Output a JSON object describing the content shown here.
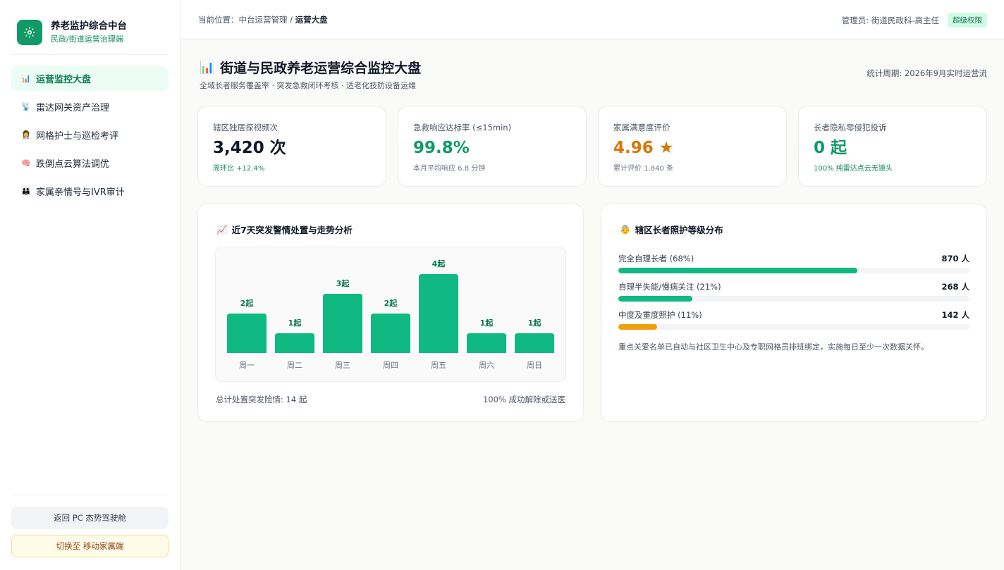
{
  "sidebar": {
    "brand_title": "养老监护综合中台",
    "brand_subtitle": "民政/街道运营治理端",
    "items": [
      {
        "icon": "📊",
        "label": "运营监控大盘",
        "active": true
      },
      {
        "icon": "📡",
        "label": "雷达网关资产治理",
        "active": false
      },
      {
        "icon": "👩‍⚕️",
        "label": "网格护士与巡检考评",
        "active": false
      },
      {
        "icon": "🧠",
        "label": "跌倒点云算法调优",
        "active": false
      },
      {
        "icon": "👪",
        "label": "家属亲情号与IVR审计",
        "active": false
      }
    ],
    "btn_back": "返回 PC 态势驾驶舱",
    "btn_switch": "切换至 移动家属端"
  },
  "topbar": {
    "crumb_prefix": "当前位置：中台运营管理 / ",
    "crumb_current": "运营大盘",
    "admin": "管理员: 街道民政科-高主任",
    "badge": "超级权限"
  },
  "page": {
    "title_icon": "📊",
    "title": "街道与民政养老运营综合监控大盘",
    "subtitle": "全域长者服务覆盖率 · 突发急救闭环考核 · 适老化技防设备运维",
    "period": "统计周期: 2026年9月实时运营流"
  },
  "kpis": [
    {
      "label": "辖区独居探视频次",
      "value": "3,420 次",
      "note": "周环比 +12.4%",
      "color": "#111827",
      "note_color": "#0f8a5f"
    },
    {
      "label": "急救响应达标率 (≤15min)",
      "value": "99.8%",
      "note": "本月平均响应 6.8 分钟",
      "color": "#0f9a67",
      "note_color": "#6b7280"
    },
    {
      "label": "家属满意度评价",
      "value": "4.96 ★",
      "note": "累计评价 1,840 条",
      "color": "#d97706",
      "note_color": "#6b7280"
    },
    {
      "label": "长者隐私零侵犯投诉",
      "value": "0 起",
      "note": "100% 纯雷达点云无镜头",
      "color": "#0f9a67",
      "note_color": "#0f8a5f"
    }
  ],
  "chart_card": {
    "icon": "📈",
    "title": "近7天突发警情处置与走势分析",
    "foot_left": "总计处置突发险情: 14 起",
    "foot_right": "100% 成功解除或送医"
  },
  "chart_data": {
    "type": "bar",
    "categories": [
      "周一",
      "周二",
      "周三",
      "周四",
      "周五",
      "周六",
      "周日"
    ],
    "values": [
      2,
      1,
      3,
      2,
      4,
      1,
      1
    ],
    "value_labels": [
      "2起",
      "1起",
      "3起",
      "2起",
      "4起",
      "1起",
      "1起"
    ],
    "ylim": [
      0,
      4
    ],
    "color": "#10b981"
  },
  "dist_card": {
    "icon": "👵",
    "title": "辖区长者照护等级分布",
    "rows": [
      {
        "label": "完全自理长者 (68%)",
        "count": "870 人",
        "fraction": 0.68,
        "color": "#10b981"
      },
      {
        "label": "自理半失能/慢病关注 (21%)",
        "count": "268 人",
        "fraction": 0.21,
        "color": "#10b981"
      },
      {
        "label": "中度及重度照护 (11%)",
        "count": "142 人",
        "fraction": 0.11,
        "color": "#f59e0b"
      }
    ],
    "note": "重点关爱名单已自动与社区卫生中心及专职网格员排班绑定，实施每日至少一次数据关怀。"
  }
}
